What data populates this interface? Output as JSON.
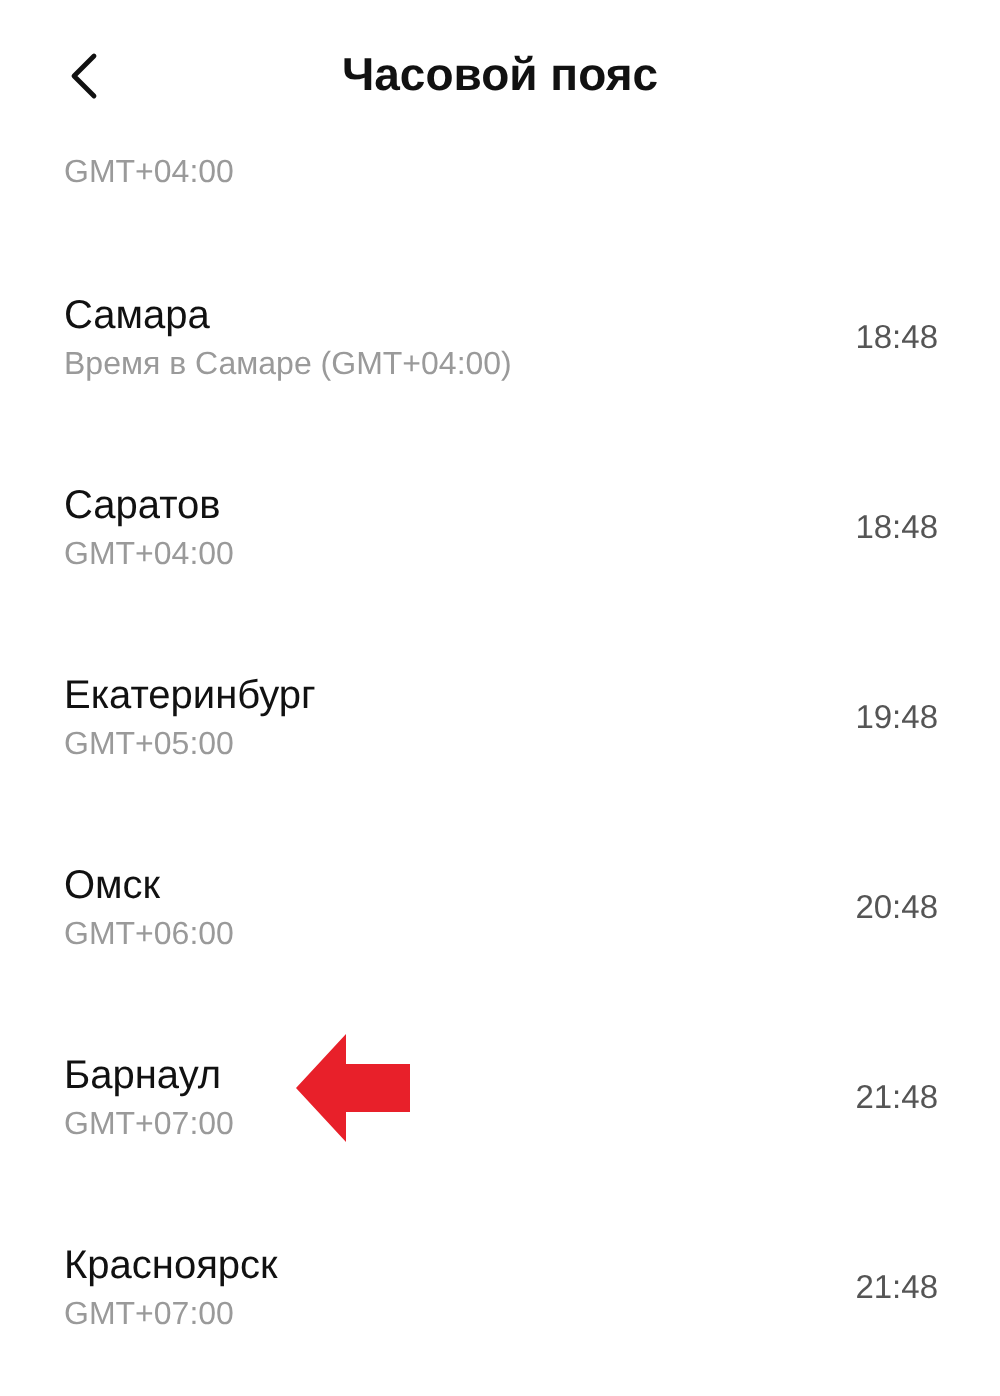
{
  "header": {
    "title": "Часовой пояс"
  },
  "partial_row": {
    "subtitle": "GMT+04:00"
  },
  "rows": [
    {
      "name": "Самара",
      "subtitle": "Время в Самаре (GMT+04:00)",
      "time": "18:48",
      "annotated": false
    },
    {
      "name": "Саратов",
      "subtitle": "GMT+04:00",
      "time": "18:48",
      "annotated": false
    },
    {
      "name": "Екатеринбург",
      "subtitle": "GMT+05:00",
      "time": "19:48",
      "annotated": false
    },
    {
      "name": "Омск",
      "subtitle": "GMT+06:00",
      "time": "20:48",
      "annotated": false
    },
    {
      "name": "Барнаул",
      "subtitle": "GMT+07:00",
      "time": "21:48",
      "annotated": true
    },
    {
      "name": "Красноярск",
      "subtitle": "GMT+07:00",
      "time": "21:48",
      "annotated": false
    }
  ]
}
